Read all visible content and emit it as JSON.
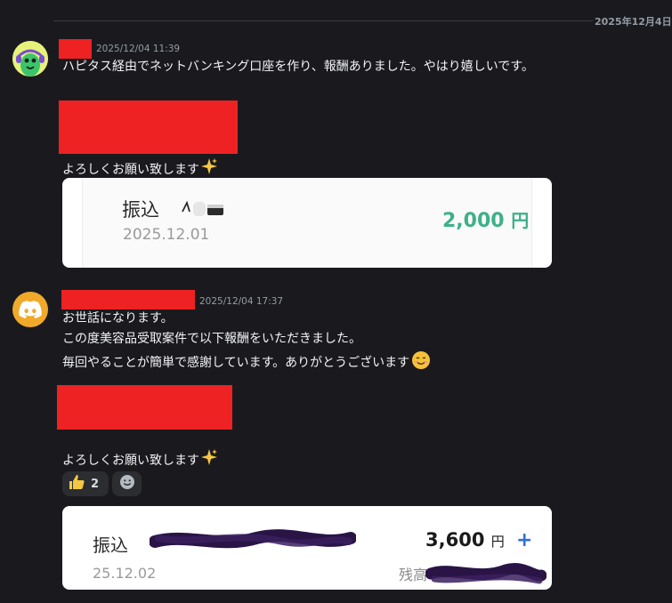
{
  "divider": {
    "date": "2025年12月4日"
  },
  "messages": [
    {
      "timestamp": "2025/12/04 11:39",
      "lines": [
        "ハピタス経由でネットバンキング口座を作り、報酬ありました。やはり嬉しいです。"
      ],
      "closing": "よろしくお願い致します",
      "closing_emoji": "sparkles-icon",
      "card": {
        "label": "振込",
        "amount": "2,000",
        "currency": "円",
        "date": "2025.12.01",
        "accent_color": "#3eb08a"
      }
    },
    {
      "timestamp": "2025/12/04 17:37",
      "lines": [
        "お世話になります。",
        "この度美容品受取案件で以下報酬をいただきました。",
        "毎回やることが簡単で感謝しています。ありがとうございます"
      ],
      "closing": "よろしくお願い致します",
      "reactions": [
        {
          "emoji": "thumbs-up-icon",
          "count": "2"
        },
        {
          "emoji": "add-reaction-icon"
        }
      ],
      "card": {
        "label": "振込",
        "amount": "3,600",
        "currency": "円",
        "plus": "+",
        "date": "25.12.02",
        "balance_label": "残高",
        "accent_color": "#2f6fde"
      }
    }
  ],
  "colors": {
    "background": "#1a1a1e",
    "redaction": "#ee2222",
    "discord_avatar": "#f1a92a"
  }
}
